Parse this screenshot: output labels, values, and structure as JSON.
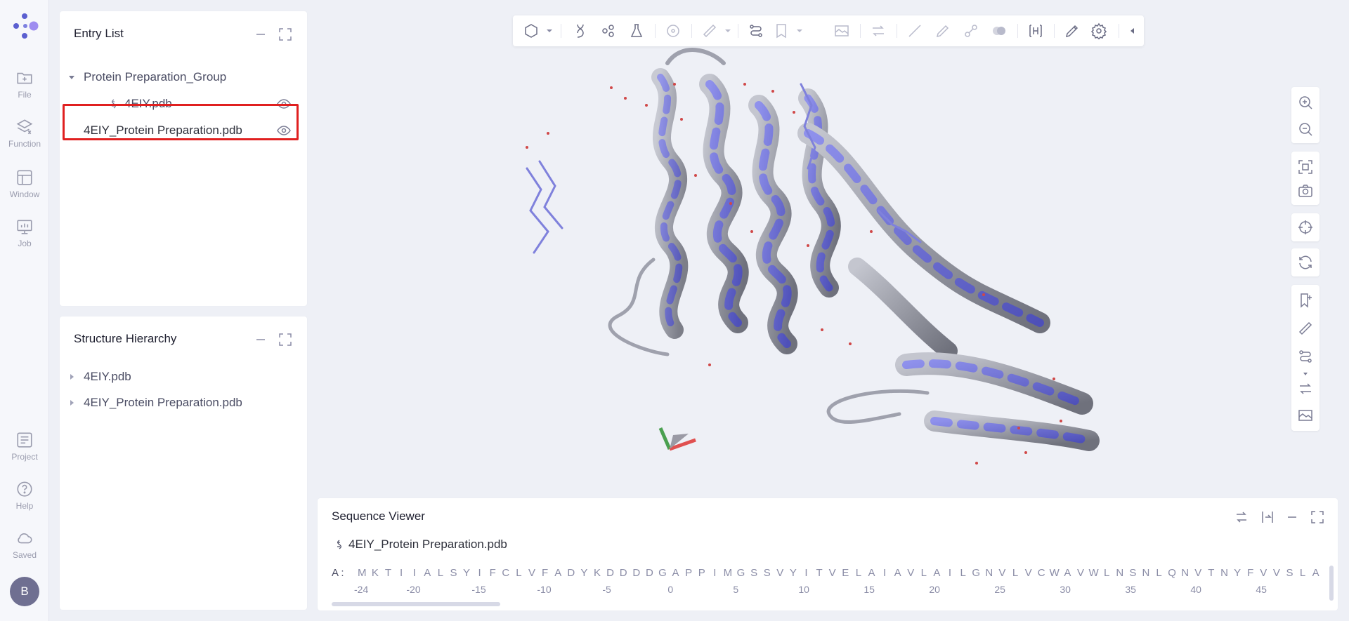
{
  "rail": {
    "items": [
      {
        "label": "File",
        "icon": "folder-plus-icon"
      },
      {
        "label": "Function",
        "icon": "layers-icon"
      },
      {
        "label": "Window",
        "icon": "window-layout-icon"
      },
      {
        "label": "Job",
        "icon": "monitor-chart-icon"
      },
      {
        "label": "Project",
        "icon": "list-icon"
      },
      {
        "label": "Help",
        "icon": "help-circle-icon"
      },
      {
        "label": "Saved",
        "icon": "cloud-icon"
      }
    ],
    "avatar": "B"
  },
  "entry_list": {
    "title": "Entry List",
    "group": "Protein Preparation_Group",
    "child": "4EIY.pdb",
    "selected": "4EIY_Protein Preparation.pdb"
  },
  "structure_hierarchy": {
    "title": "Structure Hierarchy",
    "items": [
      "4EIY.pdb",
      "4EIY_Protein Preparation.pdb"
    ]
  },
  "sequence_viewer": {
    "title": "Sequence Viewer",
    "file": "4EIY_Protein Preparation.pdb",
    "chain": "A :",
    "residues": [
      "M",
      "K",
      "T",
      "I",
      "I",
      "A",
      "L",
      "S",
      "Y",
      "I",
      "F",
      "C",
      "L",
      "V",
      "F",
      "A",
      "D",
      "Y",
      "K",
      "D",
      "D",
      "D",
      "D",
      "G",
      "A",
      "P",
      "P",
      "I",
      "M",
      "G",
      "S",
      "S",
      "V",
      "Y",
      "I",
      "T",
      "V",
      "E",
      "L",
      "A",
      "I",
      "A",
      "V",
      "L",
      "A",
      "I",
      "L",
      "G",
      "N",
      "V",
      "L",
      "V",
      "C",
      "W",
      "A",
      "V",
      "W",
      "L",
      "N",
      "S",
      "N",
      "L",
      "Q",
      "N",
      "V",
      "T",
      "N",
      "Y",
      "F",
      "V",
      "V",
      "S",
      "L",
      "A"
    ],
    "numbers": [
      "-24",
      "-20",
      "-15",
      "-10",
      "-5",
      "0",
      "5",
      "10",
      "15",
      "20",
      "25",
      "30",
      "35",
      "40",
      "45"
    ]
  },
  "colors": {
    "accent": "#6b6fd6",
    "highlight": "#e02020",
    "helix_blue": "#6d6fd3",
    "helix_gray": "#8d8f99"
  }
}
